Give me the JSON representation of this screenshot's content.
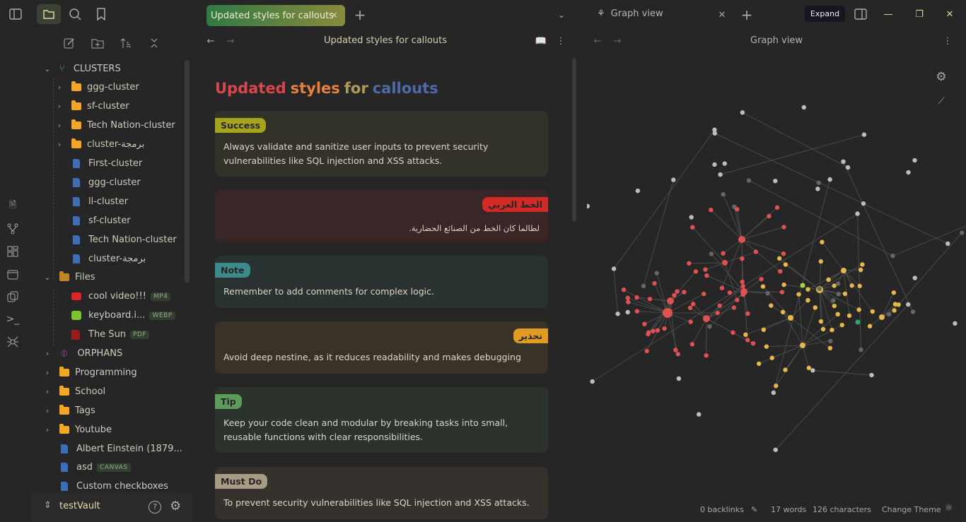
{
  "window": {
    "tooltip": "Expand"
  },
  "tabs": [
    {
      "label": "Updated styles for callouts",
      "active": true
    },
    {
      "label": "Graph view",
      "active": false
    }
  ],
  "editor": {
    "header_title": "Updated styles for callouts",
    "title_words": [
      {
        "text": "Updated",
        "color": "#d9474a"
      },
      {
        "text": "styles",
        "color": "#e8823a"
      },
      {
        "text": "for",
        "color": "#b09a5a"
      },
      {
        "text": "callouts",
        "color": "#4f6aa8"
      }
    ],
    "callouts": [
      {
        "title": "Success",
        "text": "Always validate and sanitize user inputs to prevent security vulnerabilities like SQL injection and XSS attacks.",
        "bg": "#333228",
        "accent": "#a6a31c",
        "rtl": false
      },
      {
        "title": "الخط العربي",
        "text": "لطالما كان الخط من الصنائع الحضارية.",
        "bg": "#392727",
        "accent": "#d12a27",
        "rtl": true
      },
      {
        "title": "Note",
        "text": "Remember to add comments for complex logic.",
        "bg": "#293231",
        "accent": "#3d8a8a",
        "rtl": false
      },
      {
        "title": "تحذير",
        "text": "Avoid deep nestine, as it reduces readability and makes debugging",
        "bg": "#393226",
        "accent": "#e09b22",
        "rtl": true
      },
      {
        "title": "Tip",
        "text": "Keep your code clean and modular by breaking tasks into small, reusable functions with clear responsibilities.",
        "bg": "#2c322c",
        "accent": "#5e9c5c",
        "rtl": false
      },
      {
        "title": "Must Do",
        "text": "To prevent security vulnerabilities like SQL injection and XSS attacks.",
        "bg": "#35322d",
        "accent": "#a89a85",
        "rtl": false
      }
    ]
  },
  "sidebar": {
    "vault": "testVault",
    "items": [
      {
        "label": "CLUSTERS",
        "kind": "group",
        "open": true
      },
      {
        "label": "ggg-cluster",
        "kind": "folder"
      },
      {
        "label": "sf-cluster",
        "kind": "folder"
      },
      {
        "label": "Tech Nation-cluster",
        "kind": "folder"
      },
      {
        "label": "cluster-برمجة",
        "kind": "folder"
      },
      {
        "label": "First-cluster",
        "kind": "file"
      },
      {
        "label": "ggg-cluster",
        "kind": "file"
      },
      {
        "label": "ll-cluster",
        "kind": "file"
      },
      {
        "label": "sf-cluster",
        "kind": "file"
      },
      {
        "label": "Tech Nation-cluster",
        "kind": "file"
      },
      {
        "label": "cluster-برمجة",
        "kind": "file"
      },
      {
        "label": "Files",
        "kind": "openfolder"
      },
      {
        "label": "cool video!!!",
        "kind": "video",
        "badge": "MP4"
      },
      {
        "label": "keyboard.i...",
        "kind": "image",
        "badge": "WEBP"
      },
      {
        "label": "The Sun",
        "kind": "pdf",
        "badge": "PDF"
      },
      {
        "label": "ORPHANS",
        "kind": "group"
      },
      {
        "label": "Programming",
        "kind": "folder"
      },
      {
        "label": "School",
        "kind": "folder"
      },
      {
        "label": "Tags",
        "kind": "folder"
      },
      {
        "label": "Youtube",
        "kind": "folder"
      },
      {
        "label": "Albert Einstein (1879...",
        "kind": "file"
      },
      {
        "label": "asd",
        "kind": "file",
        "badge": "CANVAS"
      },
      {
        "label": "Custom checkboxes",
        "kind": "file"
      }
    ]
  },
  "graph": {
    "header_title": "Graph view",
    "colors": {
      "red": "#e05252",
      "yellow": "#e6b84a",
      "grey": "#bdbdbd",
      "dark": "#666666",
      "lime": "#a8d44a",
      "green": "#2fa86a"
    }
  },
  "status": {
    "backlinks": "0 backlinks",
    "words": "17 words",
    "characters": "126 characters",
    "theme": "Change Theme"
  }
}
